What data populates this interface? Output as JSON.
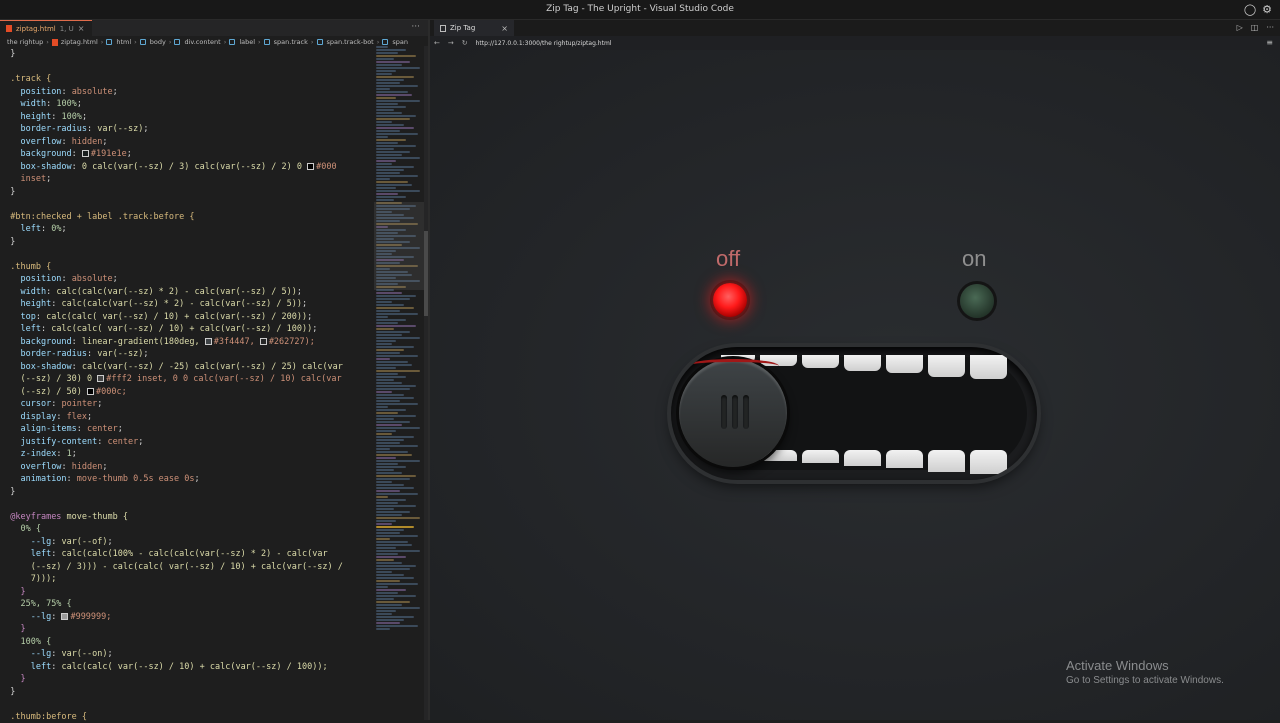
{
  "window": {
    "title": "Zip Tag - The Upright - Visual Studio Code"
  },
  "editor": {
    "tab": {
      "filename": "ziptag.html",
      "modified": "1, U"
    },
    "breadcrumb": [
      "the rightup",
      "ziptag.html",
      "html",
      "body",
      "div.content",
      "label",
      "span.track",
      "span.track-bot",
      "span"
    ],
    "colors": {
      "swatch_191e1e": "#191e1e",
      "swatch_000": "#000000",
      "swatch_3f4447": "#3f4447",
      "swatch_262727": "#262727",
      "swatch_fff2": "#ffffff22",
      "swatch_000c": "#000000cc",
      "swatch_999999": "#999999"
    },
    "code": {
      "l01": "}",
      "l03_sel": ".track {",
      "l04_p": "position",
      "l04_v": "absolute",
      "l05_p": "width",
      "l05_v": "100%",
      "l06_p": "height",
      "l06_v": "100%",
      "l07_p": "border-radius",
      "l07_v": "var(--sz)",
      "l08_p": "overflow",
      "l08_v": "hidden",
      "l09_p": "background",
      "l09_v": "#191e1e",
      "l10_p": "box-shadow",
      "l10_a": "0 calc(var(--sz) / 3) calc(var(--sz) / 2) 0",
      "l10_b": "#000",
      "l11_v": "inset",
      "l12": "}",
      "l14_sel": "#btn:checked + label .track:before {",
      "l15_p": "left",
      "l15_v": "0%",
      "l16": "}",
      "l18_sel": ".thumb {",
      "l19_p": "position",
      "l19_v": "absolute",
      "l20_p": "width",
      "l20_v": "calc(calc(var(--sz) * 2) - calc(var(--sz) / 5))",
      "l21_p": "height",
      "l21_v": "calc(calc(var(--sz) * 2) - calc(var(--sz) / 5))",
      "l22_p": "top",
      "l22_v": "calc(calc( var(--sz) / 10) + calc(var(--sz) / 200))",
      "l23_p": "left",
      "l23_v": "calc(calc( var(--sz) / 10) + calc(var(--sz) / 100))",
      "l24_p": "background",
      "l24_a": "linear-gradient(180deg, ",
      "l24_b": "#3f4447, ",
      "l24_c": "#262727);",
      "l25_p": "border-radius",
      "l25_v": "var(--sz)",
      "l26_p": "box-shadow",
      "l26_v": "calc(var(--sz) / -25) calc(var(--sz) / 25) calc(var",
      "l27_a": "(--sz) / 30) 0 ",
      "l27_b": "#fff2 inset, 0 0 calc(var(--sz) / 10) calc(var",
      "l28_a": "(--sz) / 50) ",
      "l28_b": "#000c;",
      "l29_p": "cursor",
      "l29_v": "pointer",
      "l30_p": "display",
      "l30_v": "flex",
      "l31_p": "align-items",
      "l31_v": "center",
      "l32_p": "justify-content",
      "l32_v": "center",
      "l33_p": "z-index",
      "l33_v": "1",
      "l34_p": "overflow",
      "l34_v": "hidden",
      "l35_p": "animation",
      "l35_v": "move-thumb 0.5s ease 0s",
      "l36": "}",
      "l38_kw": "@keyframes",
      "l38_n": " move-thumb {",
      "l39": "0% {",
      "l40_p": "--lg",
      "l40_v": "var(--of)",
      "l41_p": "left",
      "l41_v": "calc(calc(100% - calc(calc(var(--sz) * 2) - calc(var",
      "l42": "(--sz) / 3))) - calc(calc( var(--sz) / 10) + calc(var(--sz) /",
      "l43": "7)));",
      "l44": "}",
      "l45": "25%, 75% {",
      "l46_p": "--lg",
      "l46_v": "#999999;",
      "l47": "}",
      "l48": "100% {",
      "l49_p": "--lg",
      "l49_v": "var(--on)",
      "l50_p": "left",
      "l50_v": "calc(calc( var(--sz) / 10) + calc(var(--sz) / 100));",
      "l51": "}",
      "l52": "}",
      "l54": ".thumb:before {"
    }
  },
  "browser": {
    "tab_title": "Zip Tag",
    "url": "http://127.0.0.1:3000/the rightup/ziptag.html",
    "page": {
      "off_label": "off",
      "on_label": "on",
      "state": "off",
      "led_off_color": "#ff1a1a",
      "led_on_color": "#2c4033"
    }
  },
  "watermark": {
    "line1": "Activate Windows",
    "line2": "Go to Settings to activate Windows."
  }
}
